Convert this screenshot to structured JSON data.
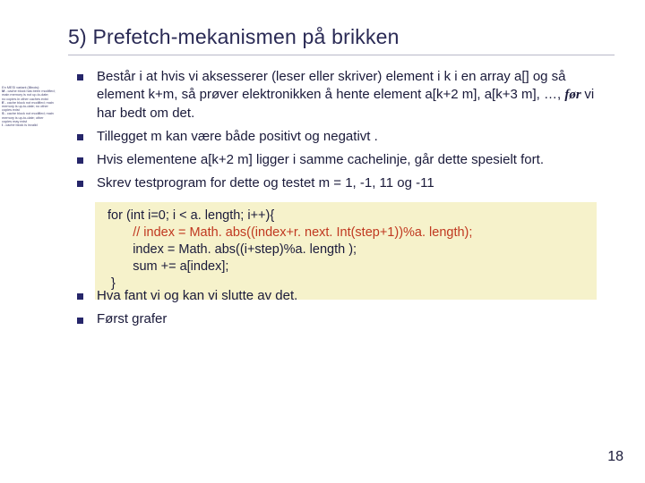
{
  "title": "5) Prefetch-mekanismen på brikken",
  "side_label_html": "En MESI variant (Illinois):<br><b>M</b> - cache block has been modified;<br>main memory is not up-to-date;<br>no copies in other caches exist<br><b>E</b> - cache block not modified; main<br>memory is up-to-date; no other<br>copies exist<br><b>S</b> - cache block not modified; main<br>memory is up-to-date; other<br>copies may exist<br><b>I</b> - cache block is invalid",
  "bullets_top": [
    {
      "pre": "Består i at hvis vi aksesserer (leser eller skriver)  element i k i en array a[] og så element k+m, så prøver elektronikken å hente element a[k+2 m], a[k+3 m], …, ",
      "em": "før ",
      "post": " vi har bedt om det."
    },
    {
      "pre": "Tillegget m kan være både positivt og negativt .",
      "em": "",
      "post": ""
    },
    {
      "pre": "Hvis elementene a[k+2 m] ligger i samme cachelinje, går dette spesielt fort.",
      "em": "",
      "post": ""
    },
    {
      "pre": "Skrev testprogram for dette og testet m = 1, -1, 11 og -11",
      "em": "",
      "post": ""
    }
  ],
  "code": {
    "l1": "for (int i=0; i < a. length; i++){",
    "l2_comment": "       // index = Math. abs((index+r. next. Int(step+1))%a. length);",
    "l3": "       index = Math. abs((i+step)%a. length );",
    "l4": "       sum += a[index];",
    "l5": " }"
  },
  "bullets_bottom": [
    "Hva fant vi og kan vi slutte av det.",
    "Først grafer"
  ],
  "pagenum": "18"
}
